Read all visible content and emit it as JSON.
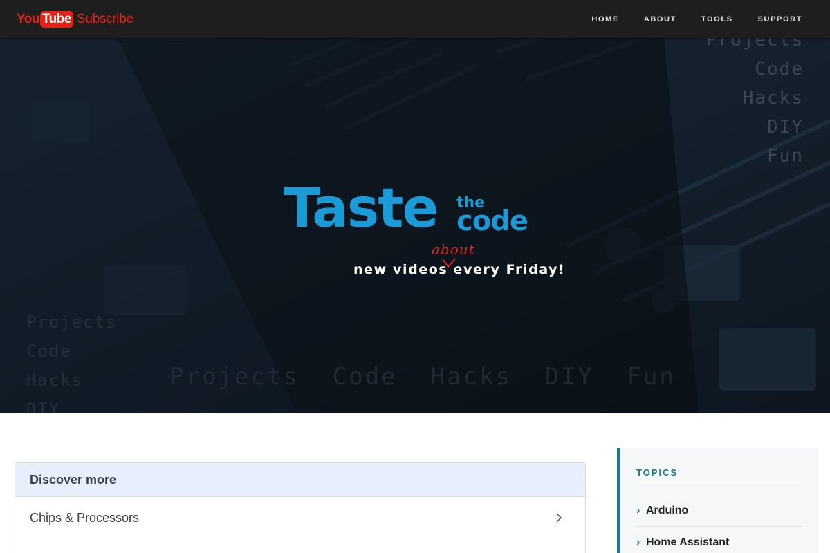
{
  "header": {
    "logo": {
      "you": "You",
      "tube": "Tube",
      "subscribe": "Subscribe"
    },
    "nav": [
      "HOME",
      "ABOUT",
      "TOOLS",
      "SUPPORT"
    ]
  },
  "hero": {
    "bg_words_right": [
      "Projects",
      "Code",
      "Hacks",
      "DIY",
      "Fun"
    ],
    "bg_words_left": [
      "Projects",
      "Code",
      "Hacks",
      "DIY"
    ],
    "bg_words_bottom": [
      "Projects",
      "Code",
      "Hacks",
      "DIY",
      "Fun"
    ],
    "logo_big": "Taste",
    "logo_small": "the",
    "logo_code": "code",
    "tagline": "new videos every Friday!",
    "tagline_insert": "about",
    "accent_color": "#1a9ad6",
    "insert_color": "#e2231a"
  },
  "discover": {
    "title": "Discover more",
    "items": [
      "Chips & Processors"
    ]
  },
  "topics": {
    "title": "TOPICS",
    "items": [
      "Arduino",
      "Home Assistant"
    ]
  }
}
